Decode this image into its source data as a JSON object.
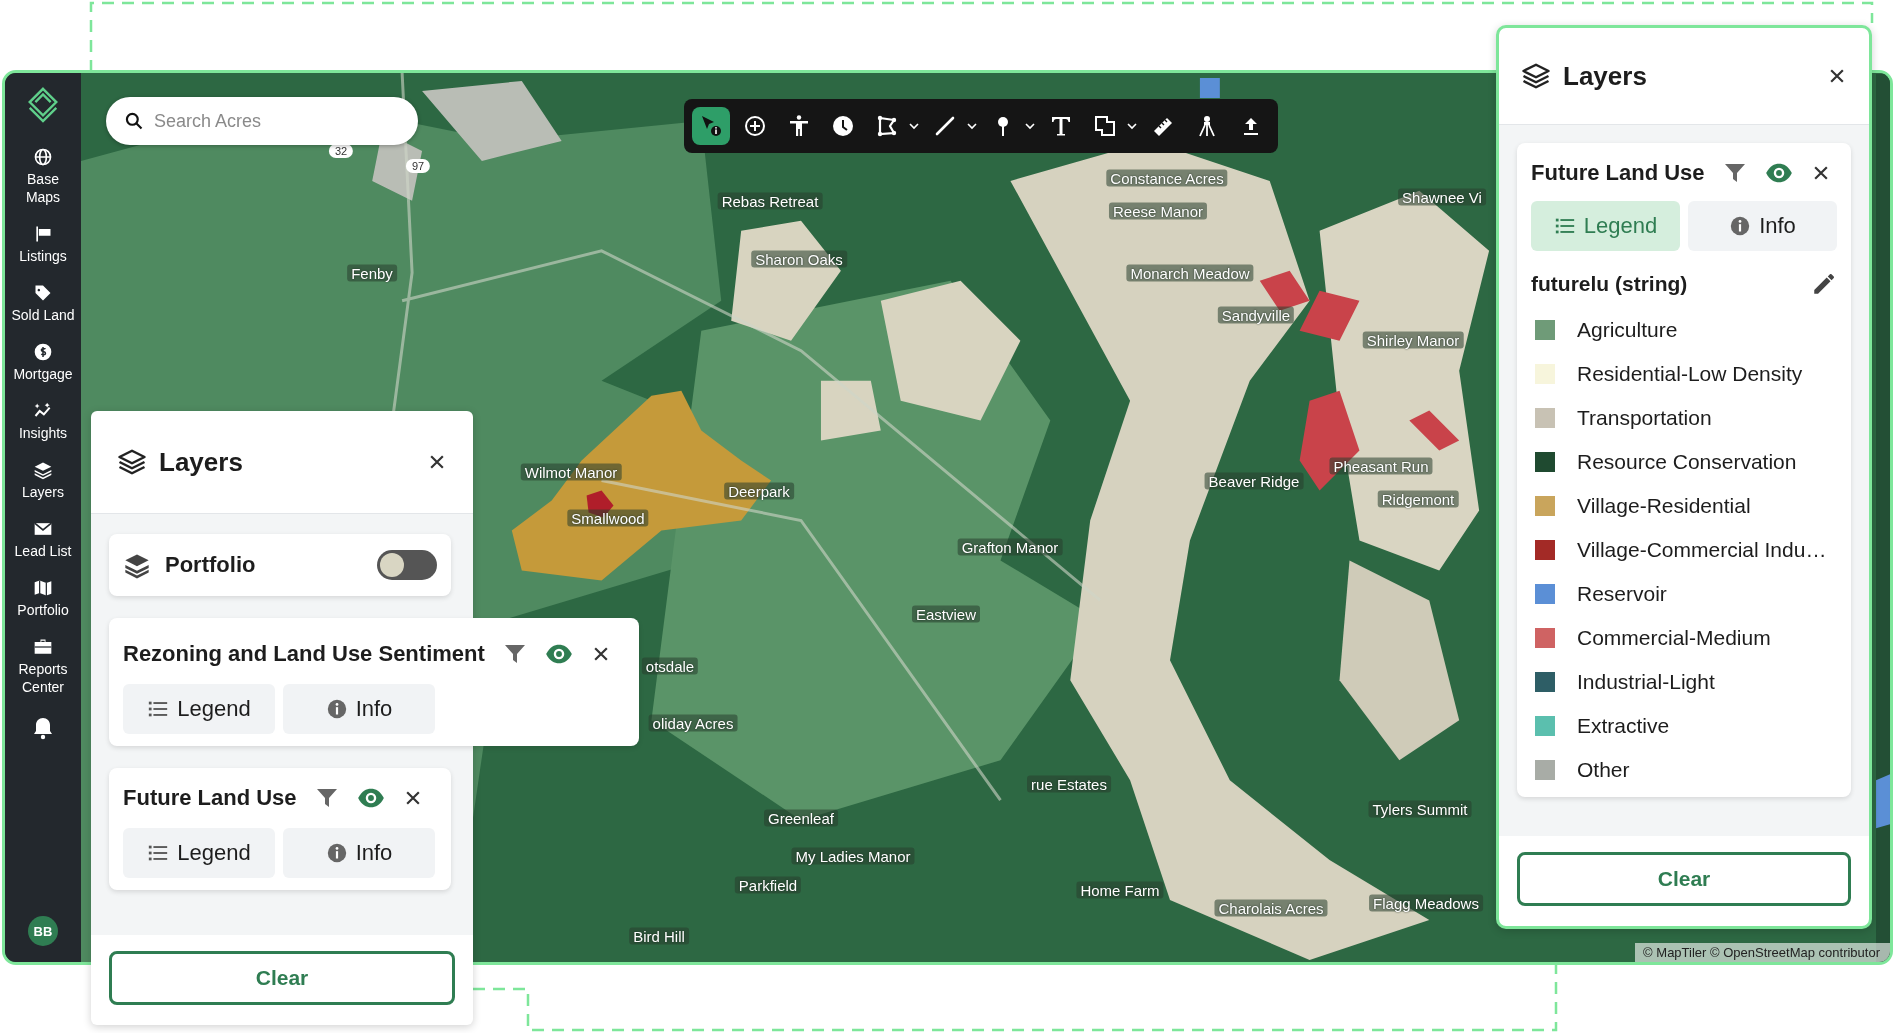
{
  "sidebar": {
    "items": [
      {
        "label": "Base Maps"
      },
      {
        "label": "Listings"
      },
      {
        "label": "Sold Land"
      },
      {
        "label": "Mortgage"
      },
      {
        "label": "Insights"
      },
      {
        "label": "Layers"
      },
      {
        "label": "Lead List"
      },
      {
        "label": "Portfolio"
      },
      {
        "label": "Reports Center"
      }
    ],
    "avatar": "BB"
  },
  "search": {
    "placeholder": "Search Acres"
  },
  "toolbar": {
    "tools": [
      {
        "selected": true,
        "dropdown": false
      },
      {
        "selected": false,
        "dropdown": false
      },
      {
        "selected": false,
        "dropdown": false
      },
      {
        "selected": false,
        "dropdown": false
      },
      {
        "selected": false,
        "dropdown": true
      },
      {
        "selected": false,
        "dropdown": true
      },
      {
        "selected": false,
        "dropdown": true
      },
      {
        "selected": false,
        "dropdown": false
      },
      {
        "selected": false,
        "dropdown": true
      },
      {
        "selected": false,
        "dropdown": false
      },
      {
        "selected": false,
        "dropdown": false
      },
      {
        "selected": false,
        "dropdown": false
      }
    ]
  },
  "map": {
    "labels": [
      "Rebas Retreat",
      "Sharon Oaks",
      "Fenby",
      "Constance Acres",
      "Reese Manor",
      "Shawnee Vi",
      "Monarch Meadow",
      "Sandyville",
      "Shirley Manor",
      "Wilmot Manor",
      "Deerpark",
      "Smallwood",
      "Pheasant Run",
      "Ridgemont",
      "Beaver Ridge",
      "Grafton Manor",
      "Eastview",
      "otsdale",
      "oliday Acres",
      "rue Estates",
      "Greenleaf",
      "My Ladies Manor",
      "Parkfield",
      "Home Farm",
      "Charolais Acres",
      "Tylers Summit",
      "Flagg Meadows",
      "Bird Hill"
    ],
    "road_shields": [
      "32",
      "97"
    ],
    "attribution": "© MapTiler © OpenStreetMap contributor"
  },
  "left_panel": {
    "title": "Layers",
    "layers": [
      {
        "kind": "toggle",
        "name": "Portfolio",
        "on": false
      },
      {
        "kind": "layer",
        "name": "Rezoning and Land Use Sentiment",
        "visible": true,
        "buttons": [
          {
            "label": "Legend",
            "selected": false
          },
          {
            "label": "Info",
            "selected": false
          }
        ]
      },
      {
        "kind": "layer",
        "name": "Future Land Use",
        "visible": true,
        "buttons": [
          {
            "label": "Legend",
            "selected": false
          },
          {
            "label": "Info",
            "selected": false
          }
        ]
      }
    ],
    "clear": "Clear"
  },
  "right_panel": {
    "title": "Layers",
    "layer": {
      "name": "Future Land Use",
      "visible": true,
      "buttons": [
        {
          "label": "Legend",
          "selected": true
        },
        {
          "label": "Info",
          "selected": false
        }
      ],
      "field": "futurelu (string)",
      "legend": [
        {
          "label": "Agriculture",
          "color": "#6f9b78"
        },
        {
          "label": "Residential-Low Density",
          "color": "#f7f5dc"
        },
        {
          "label": "Transportation",
          "color": "#c8c2b4"
        },
        {
          "label": "Resource Conservation",
          "color": "#1f4a30"
        },
        {
          "label": "Village-Residential",
          "color": "#c9a55c"
        },
        {
          "label": "Village-Commercial Indu…",
          "color": "#a32a26"
        },
        {
          "label": "Reservoir",
          "color": "#5b8fd6"
        },
        {
          "label": "Commercial-Medium",
          "color": "#cf6363"
        },
        {
          "label": "Industrial-Light",
          "color": "#2e5e66"
        },
        {
          "label": "Extractive",
          "color": "#5bbfae"
        },
        {
          "label": "Other",
          "color": "#a8aca6"
        }
      ]
    },
    "clear": "Clear"
  }
}
